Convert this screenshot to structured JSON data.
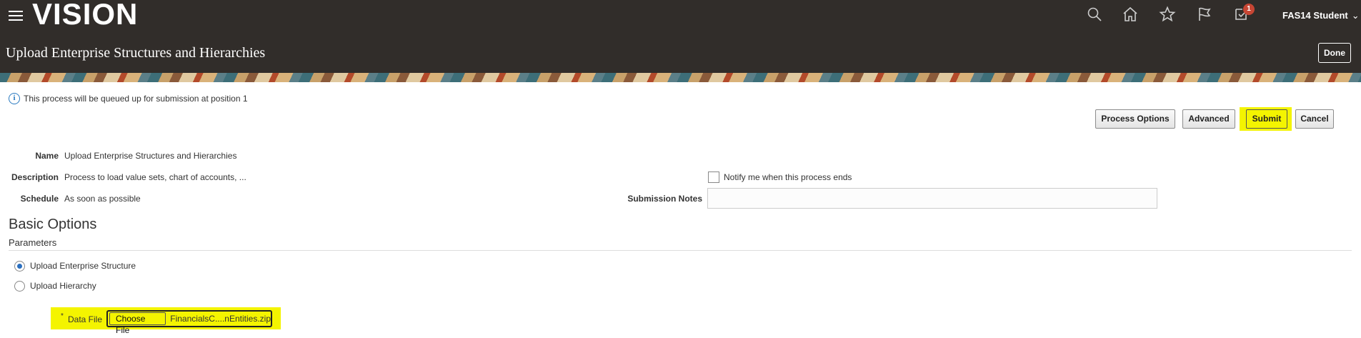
{
  "header": {
    "logo": "VISION",
    "user_name": "FAS14 Student",
    "notification_count": "1",
    "page_title": "Upload Enterprise Structures and Hierarchies",
    "done_label": "Done"
  },
  "info_message": "This process will be queued up for submission at position 1",
  "actions": {
    "process_options": "Process Options",
    "advanced": "Advanced",
    "submit": "Submit",
    "cancel": "Cancel"
  },
  "details": {
    "name_label": "Name",
    "name_value": "Upload Enterprise Structures and Hierarchies",
    "description_label": "Description",
    "description_value": "Process to load value sets, chart of accounts, ...",
    "schedule_label": "Schedule",
    "schedule_value": "As soon as possible",
    "notify_label": "Notify me when this process ends",
    "submission_notes_label": "Submission Notes",
    "submission_notes_value": ""
  },
  "basic_options": {
    "title": "Basic Options",
    "parameters_label": "Parameters",
    "radio_options": [
      "Upload Enterprise Structure",
      "Upload Hierarchy"
    ],
    "selected_index": 0,
    "required_marker": "*",
    "data_file_label": "Data File",
    "choose_file_label": "Choose File",
    "file_name": "FinancialsC....nEntities.zip"
  },
  "colors": {
    "header_bg": "#312d2a",
    "highlight": "#f4f400",
    "accent": "#2a6fbf",
    "badge": "#c74634"
  },
  "icons": [
    "menu-icon",
    "search-icon",
    "home-icon",
    "star-icon",
    "flag-icon",
    "notifications-icon",
    "chevron-down-icon",
    "info-icon"
  ]
}
